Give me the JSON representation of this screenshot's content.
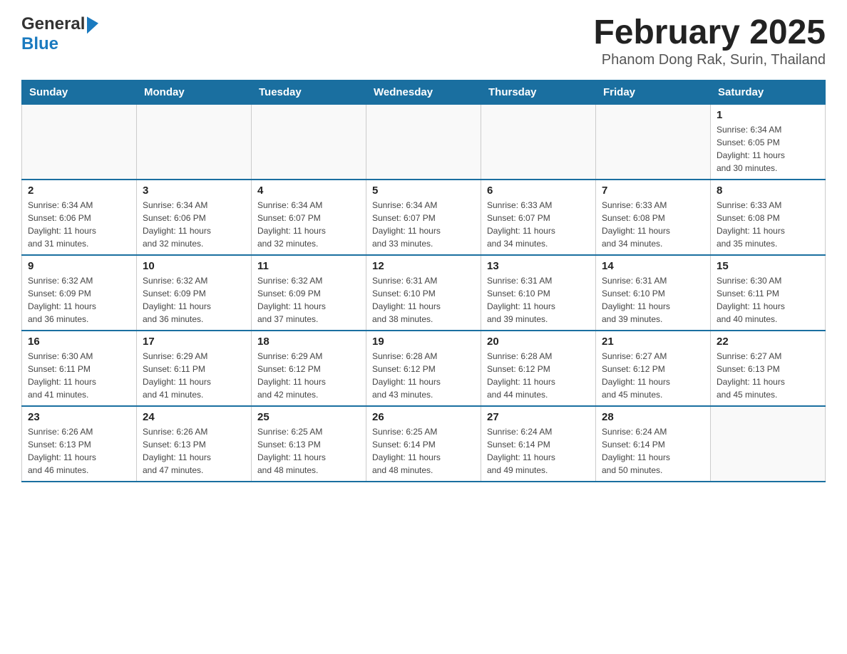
{
  "header": {
    "logo_general": "General",
    "logo_blue": "Blue",
    "title": "February 2025",
    "subtitle": "Phanom Dong Rak, Surin, Thailand"
  },
  "days_of_week": [
    "Sunday",
    "Monday",
    "Tuesday",
    "Wednesday",
    "Thursday",
    "Friday",
    "Saturday"
  ],
  "weeks": [
    [
      {
        "day": "",
        "info": ""
      },
      {
        "day": "",
        "info": ""
      },
      {
        "day": "",
        "info": ""
      },
      {
        "day": "",
        "info": ""
      },
      {
        "day": "",
        "info": ""
      },
      {
        "day": "",
        "info": ""
      },
      {
        "day": "1",
        "info": "Sunrise: 6:34 AM\nSunset: 6:05 PM\nDaylight: 11 hours\nand 30 minutes."
      }
    ],
    [
      {
        "day": "2",
        "info": "Sunrise: 6:34 AM\nSunset: 6:06 PM\nDaylight: 11 hours\nand 31 minutes."
      },
      {
        "day": "3",
        "info": "Sunrise: 6:34 AM\nSunset: 6:06 PM\nDaylight: 11 hours\nand 32 minutes."
      },
      {
        "day": "4",
        "info": "Sunrise: 6:34 AM\nSunset: 6:07 PM\nDaylight: 11 hours\nand 32 minutes."
      },
      {
        "day": "5",
        "info": "Sunrise: 6:34 AM\nSunset: 6:07 PM\nDaylight: 11 hours\nand 33 minutes."
      },
      {
        "day": "6",
        "info": "Sunrise: 6:33 AM\nSunset: 6:07 PM\nDaylight: 11 hours\nand 34 minutes."
      },
      {
        "day": "7",
        "info": "Sunrise: 6:33 AM\nSunset: 6:08 PM\nDaylight: 11 hours\nand 34 minutes."
      },
      {
        "day": "8",
        "info": "Sunrise: 6:33 AM\nSunset: 6:08 PM\nDaylight: 11 hours\nand 35 minutes."
      }
    ],
    [
      {
        "day": "9",
        "info": "Sunrise: 6:32 AM\nSunset: 6:09 PM\nDaylight: 11 hours\nand 36 minutes."
      },
      {
        "day": "10",
        "info": "Sunrise: 6:32 AM\nSunset: 6:09 PM\nDaylight: 11 hours\nand 36 minutes."
      },
      {
        "day": "11",
        "info": "Sunrise: 6:32 AM\nSunset: 6:09 PM\nDaylight: 11 hours\nand 37 minutes."
      },
      {
        "day": "12",
        "info": "Sunrise: 6:31 AM\nSunset: 6:10 PM\nDaylight: 11 hours\nand 38 minutes."
      },
      {
        "day": "13",
        "info": "Sunrise: 6:31 AM\nSunset: 6:10 PM\nDaylight: 11 hours\nand 39 minutes."
      },
      {
        "day": "14",
        "info": "Sunrise: 6:31 AM\nSunset: 6:10 PM\nDaylight: 11 hours\nand 39 minutes."
      },
      {
        "day": "15",
        "info": "Sunrise: 6:30 AM\nSunset: 6:11 PM\nDaylight: 11 hours\nand 40 minutes."
      }
    ],
    [
      {
        "day": "16",
        "info": "Sunrise: 6:30 AM\nSunset: 6:11 PM\nDaylight: 11 hours\nand 41 minutes."
      },
      {
        "day": "17",
        "info": "Sunrise: 6:29 AM\nSunset: 6:11 PM\nDaylight: 11 hours\nand 41 minutes."
      },
      {
        "day": "18",
        "info": "Sunrise: 6:29 AM\nSunset: 6:12 PM\nDaylight: 11 hours\nand 42 minutes."
      },
      {
        "day": "19",
        "info": "Sunrise: 6:28 AM\nSunset: 6:12 PM\nDaylight: 11 hours\nand 43 minutes."
      },
      {
        "day": "20",
        "info": "Sunrise: 6:28 AM\nSunset: 6:12 PM\nDaylight: 11 hours\nand 44 minutes."
      },
      {
        "day": "21",
        "info": "Sunrise: 6:27 AM\nSunset: 6:12 PM\nDaylight: 11 hours\nand 45 minutes."
      },
      {
        "day": "22",
        "info": "Sunrise: 6:27 AM\nSunset: 6:13 PM\nDaylight: 11 hours\nand 45 minutes."
      }
    ],
    [
      {
        "day": "23",
        "info": "Sunrise: 6:26 AM\nSunset: 6:13 PM\nDaylight: 11 hours\nand 46 minutes."
      },
      {
        "day": "24",
        "info": "Sunrise: 6:26 AM\nSunset: 6:13 PM\nDaylight: 11 hours\nand 47 minutes."
      },
      {
        "day": "25",
        "info": "Sunrise: 6:25 AM\nSunset: 6:13 PM\nDaylight: 11 hours\nand 48 minutes."
      },
      {
        "day": "26",
        "info": "Sunrise: 6:25 AM\nSunset: 6:14 PM\nDaylight: 11 hours\nand 48 minutes."
      },
      {
        "day": "27",
        "info": "Sunrise: 6:24 AM\nSunset: 6:14 PM\nDaylight: 11 hours\nand 49 minutes."
      },
      {
        "day": "28",
        "info": "Sunrise: 6:24 AM\nSunset: 6:14 PM\nDaylight: 11 hours\nand 50 minutes."
      },
      {
        "day": "",
        "info": ""
      }
    ]
  ]
}
